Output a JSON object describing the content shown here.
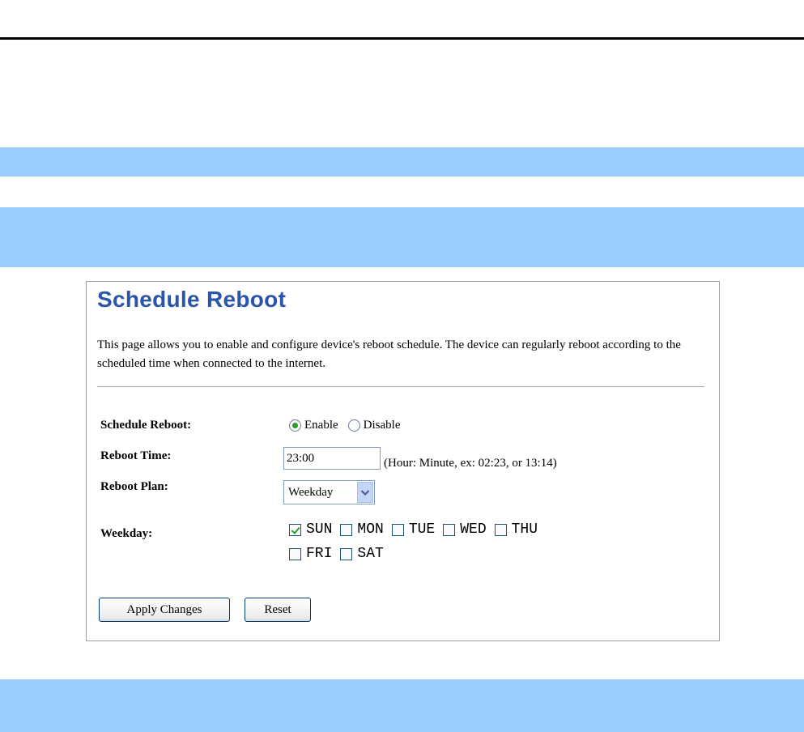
{
  "panel": {
    "title": "Schedule Reboot",
    "description": "This page allows you to enable and configure device's reboot schedule. The device can regularly reboot according to the scheduled time when connected to the internet."
  },
  "form": {
    "schedule_label": "Schedule Reboot:",
    "enable_label": "Enable",
    "disable_label": "Disable",
    "schedule_selected": "Enable",
    "time_label": "Reboot Time:",
    "time_value": "23:00",
    "time_hint": "(Hour: Minute, ex: 02:23, or 13:14)",
    "plan_label": "Reboot Plan:",
    "plan_value": "Weekday",
    "weekday_label": "Weekday:",
    "days": [
      {
        "label": "SUN",
        "checked": true
      },
      {
        "label": "MON",
        "checked": false
      },
      {
        "label": "TUE",
        "checked": false
      },
      {
        "label": "WED",
        "checked": false
      },
      {
        "label": "THU",
        "checked": false
      },
      {
        "label": "FRI",
        "checked": false
      },
      {
        "label": "SAT",
        "checked": false
      }
    ]
  },
  "buttons": {
    "apply": "Apply Changes",
    "reset": "Reset"
  },
  "colors": {
    "band": "#99ccff",
    "title": "#2a55a8"
  }
}
